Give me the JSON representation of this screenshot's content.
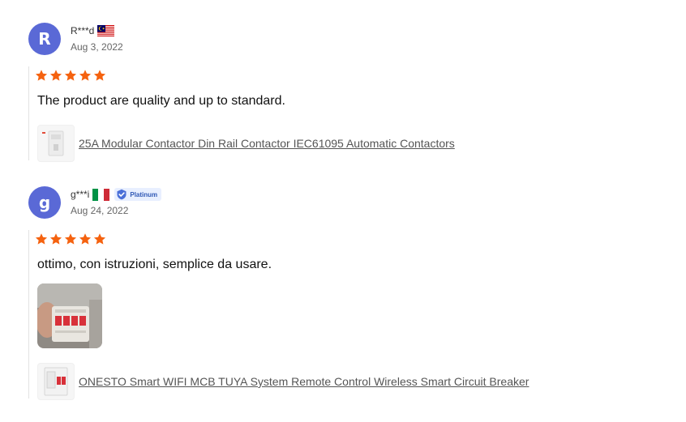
{
  "reviews": [
    {
      "avatar_letter": "R",
      "name": "R***d",
      "country_flag": "malaysia",
      "date": "Aug 3, 2022",
      "rating": 5,
      "text": "The product are quality and up to standard.",
      "product_title": "25A Modular Contactor Din Rail Contactor IEC61095 Automatic Contactors"
    },
    {
      "avatar_letter": "g",
      "name": "g***i",
      "country_flag": "italy",
      "badge": "Platinum",
      "date": "Aug 24, 2022",
      "rating": 5,
      "text": "ottimo, con istruzioni, semplice da usare.",
      "product_title": "ONESTO Smart WIFI MCB TUYA System Remote Control Wireless Smart Circuit Breaker"
    }
  ],
  "colors": {
    "star": "#f5620f",
    "avatar": "#5a69d6",
    "badge": "#2f58b5"
  }
}
